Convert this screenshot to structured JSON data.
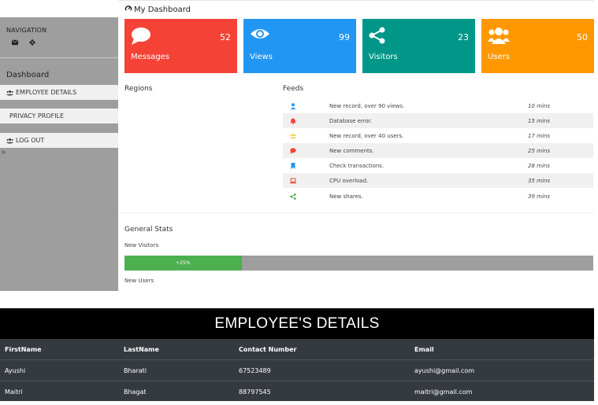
{
  "sidebar": {
    "nav_heading": "NAVIGATION",
    "dashboard_label": "Dashboard",
    "items": [
      {
        "label": "EMPLOYEE DETAILS",
        "icon": "users-icon"
      },
      {
        "label": "PRIVACY PROFILE"
      },
      {
        "label": "LOG OUT",
        "icon": "users-icon"
      }
    ],
    "caret": ">"
  },
  "header": {
    "title": "My Dashboard",
    "icon": "dashboard-icon"
  },
  "cards": [
    {
      "label": "Messages",
      "count": "52",
      "color": "#f44336",
      "icon": "comment-icon"
    },
    {
      "label": "Views",
      "count": "99",
      "color": "#2196f3",
      "icon": "eye-icon"
    },
    {
      "label": "Visitors",
      "count": "23",
      "color": "#009688",
      "icon": "share-icon"
    },
    {
      "label": "Users",
      "count": "50",
      "color": "#ff9800",
      "icon": "users-icon"
    }
  ],
  "regions": {
    "heading": "Regions"
  },
  "feeds": {
    "heading": "Feeds",
    "items": [
      {
        "text": "New record, over 90 views.",
        "time": "10 mins",
        "icon": "user-icon",
        "color": "#2196f3"
      },
      {
        "text": "Database error.",
        "time": "15 mins",
        "icon": "bell-icon",
        "color": "#f44336"
      },
      {
        "text": "New record, over 40 users.",
        "time": "17 mins",
        "icon": "users-icon",
        "color": "#ffc107"
      },
      {
        "text": "New comments.",
        "time": "25 mins",
        "icon": "comment-icon",
        "color": "#f44336"
      },
      {
        "text": "Check transactions.",
        "time": "28 mins",
        "icon": "bookmark-icon",
        "color": "#2196f3"
      },
      {
        "text": "CPU overload.",
        "time": "35 mins",
        "icon": "laptop-icon",
        "color": "#f44336"
      },
      {
        "text": "New shares.",
        "time": "39 mins",
        "icon": "share-icon",
        "color": "#4caf50"
      }
    ]
  },
  "stats": {
    "heading": "General Stats",
    "new_visitors_label": "New Visitors",
    "progress_label": "+25%",
    "progress_value": 0.25,
    "new_users_label": "New Users"
  },
  "employees": {
    "title": "EMPLOYEE'S DETAILS",
    "columns": [
      "FirstName",
      "LastName",
      "Contact Number",
      "Email"
    ],
    "rows": [
      [
        "Ayushi",
        "Bharati",
        "67523489",
        "ayushi@gmail.com"
      ],
      [
        "Maitri",
        "Bhagat",
        "88797545",
        "maitri@gmail.com"
      ]
    ]
  }
}
